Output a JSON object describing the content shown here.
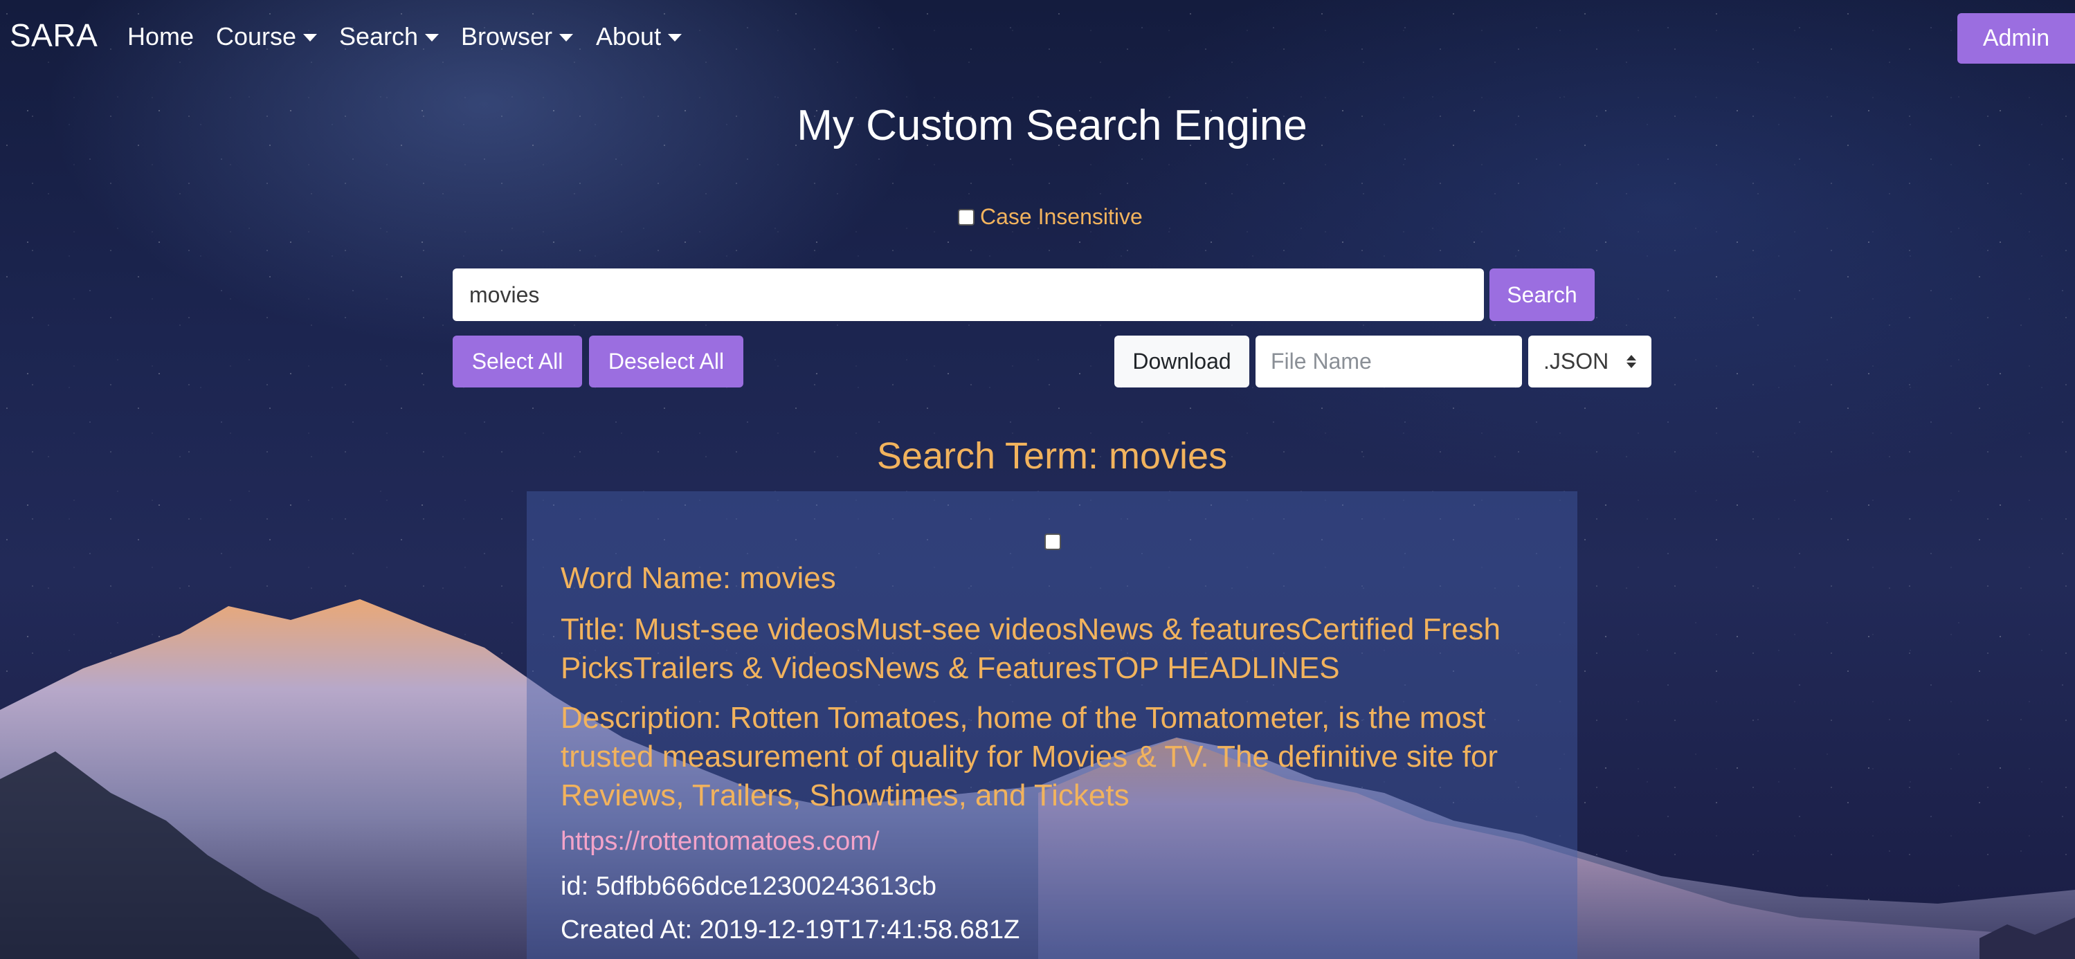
{
  "navbar": {
    "brand": "SARA",
    "items": [
      {
        "label": "Home"
      },
      {
        "label": "Course"
      },
      {
        "label": "Search"
      },
      {
        "label": "Browser"
      },
      {
        "label": "About"
      }
    ],
    "admin_label": "Admin"
  },
  "page": {
    "title": "My Custom Search Engine",
    "case_insensitive_label": "Case Insensitive",
    "case_insensitive_checked": false
  },
  "search": {
    "input_value": "movies",
    "button_label": "Search",
    "select_all_label": "Select All",
    "deselect_all_label": "Deselect All",
    "download_label": "Download",
    "filename_placeholder": "File Name",
    "format_selected": ".JSON"
  },
  "results": {
    "term_heading": "Search Term: movies",
    "items": [
      {
        "checked": false,
        "word_name": "Word Name: movies",
        "title": "Title: Must-see videosMust-see videosNews & featuresCertified Fresh PicksTrailers & VideosNews & FeaturesTOP HEADLINES",
        "description": "Description: Rotten Tomatoes, home of the Tomatometer, is the most trusted measurement of quality for Movies & TV. The definitive site for Reviews, Trailers, Showtimes, and Tickets",
        "url": "https://rottentomatoes.com/",
        "id": "id: 5dfbb666dce12300243613cb",
        "created_at": "Created At: 2019-12-19T17:41:58.681Z"
      }
    ]
  },
  "colors": {
    "accent_purple": "#9b6ee0",
    "gold_text": "#f2b35d",
    "link_pink": "#f4a3c9"
  }
}
